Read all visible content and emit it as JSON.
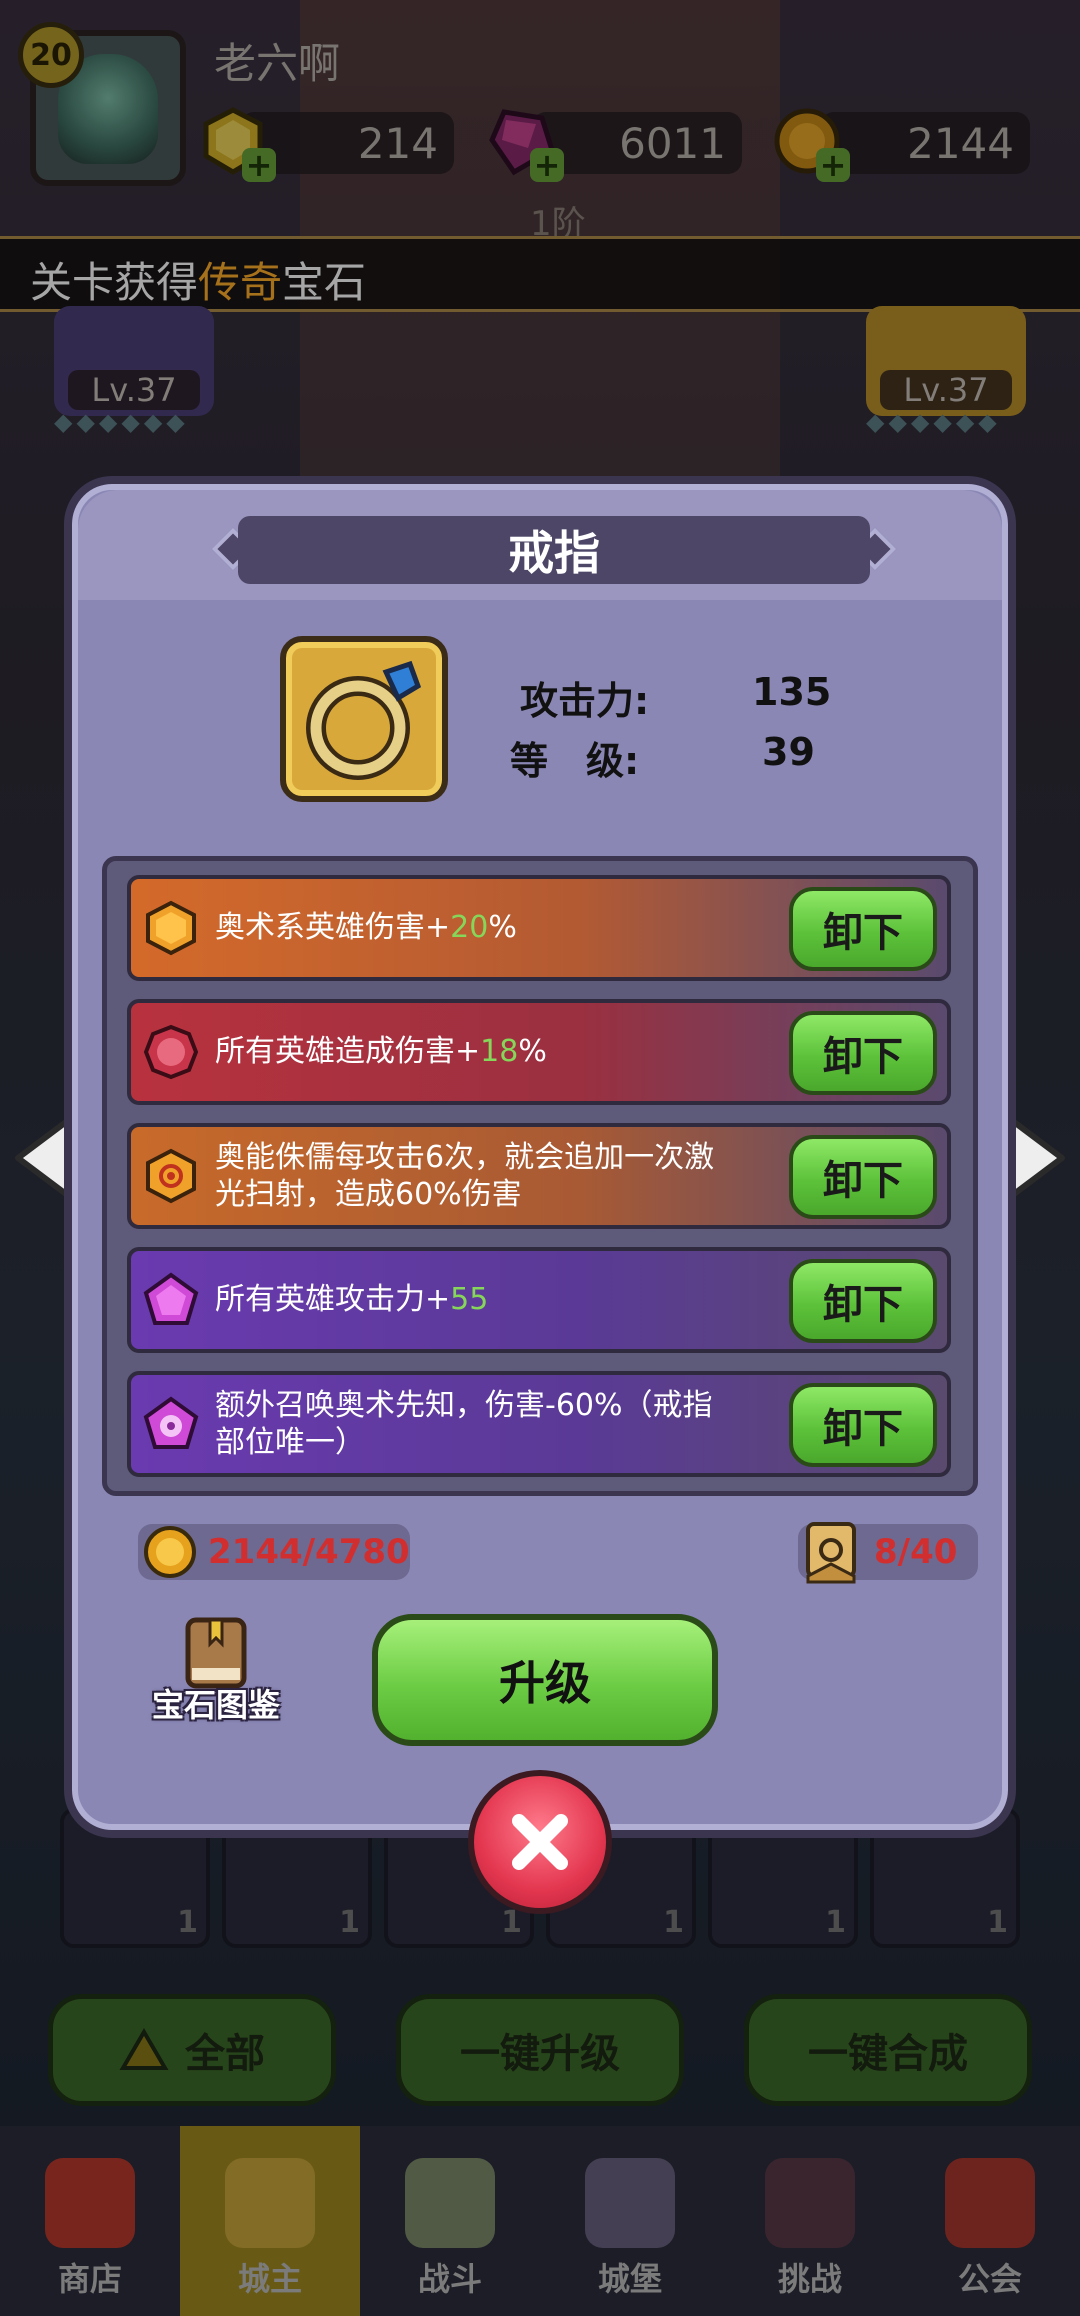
{
  "header": {
    "player_level": "20",
    "player_name": "老六啊",
    "resources": [
      {
        "icon": "gold-hexagon-icon",
        "value": "214"
      },
      {
        "icon": "purple-crystal-icon",
        "value": "6011"
      },
      {
        "icon": "coin-icon",
        "value": "2144"
      }
    ],
    "tier_text": "1阶"
  },
  "banner": {
    "prefix": "关卡获得",
    "highlight": "传奇",
    "suffix": "宝石"
  },
  "side_cards": {
    "left_level": "Lv.37",
    "right_level": "Lv.37"
  },
  "modal": {
    "title": "戒指",
    "stats": [
      {
        "label": "攻击力:",
        "value": "135"
      },
      {
        "label": "等　级:",
        "value": "39"
      }
    ],
    "effects": [
      {
        "icon": "orange-hexagon-gem-icon",
        "text_before": "奥术系英雄伤害+",
        "highlight": "20",
        "text_after": "%",
        "bg": "#c86a2f",
        "button": "卸下"
      },
      {
        "icon": "red-round-gem-icon",
        "text_before": "所有英雄造成伤害+",
        "highlight": "18",
        "text_after": "%",
        "bg": "#a6353f",
        "button": "卸下"
      },
      {
        "icon": "orange-swirl-gem-icon",
        "text_line1": "奥能侏儒每攻击6次，就会追加一次激",
        "text_line2": "光扫射，造成60%伤害",
        "bg": "#c0682e",
        "button": "卸下"
      },
      {
        "icon": "purple-pentagon-gem-icon",
        "text_before": "所有英雄攻击力+",
        "highlight": "55",
        "text_after": "",
        "bg": "#6a3aa6",
        "button": "卸下"
      },
      {
        "icon": "purple-eye-gem-icon",
        "text_line1": "额外召唤奥术先知，伤害-60%（戒指",
        "text_line2": "部位唯一）",
        "bg": "#6a3aa6",
        "button": "卸下"
      }
    ],
    "coin_cost": "2144/4780",
    "scroll_cost": "8/40",
    "gem_book_label": "宝石图鉴",
    "upgrade_label": "升级"
  },
  "bottom": {
    "slot_counts": [
      "1",
      "1",
      "1",
      "1",
      "1",
      "1"
    ],
    "buttons": [
      "全部",
      "一键升级",
      "一键合成"
    ]
  },
  "tabs": [
    {
      "label": "商店",
      "icon": "shop-icon"
    },
    {
      "label": "城主",
      "icon": "crown-icon"
    },
    {
      "label": "战斗",
      "icon": "crossed-swords-icon"
    },
    {
      "label": "城堡",
      "icon": "castle-icon"
    },
    {
      "label": "挑战",
      "icon": "demon-mask-icon"
    },
    {
      "label": "公会",
      "icon": "guild-banner-icon"
    }
  ],
  "colors": {
    "modal_bg": "#8a87b5",
    "highlight_orange": "#ffae2a",
    "bonus_green": "#86d65a",
    "cost_red": "#d12f2f",
    "active_tab": "#a08b1f"
  }
}
